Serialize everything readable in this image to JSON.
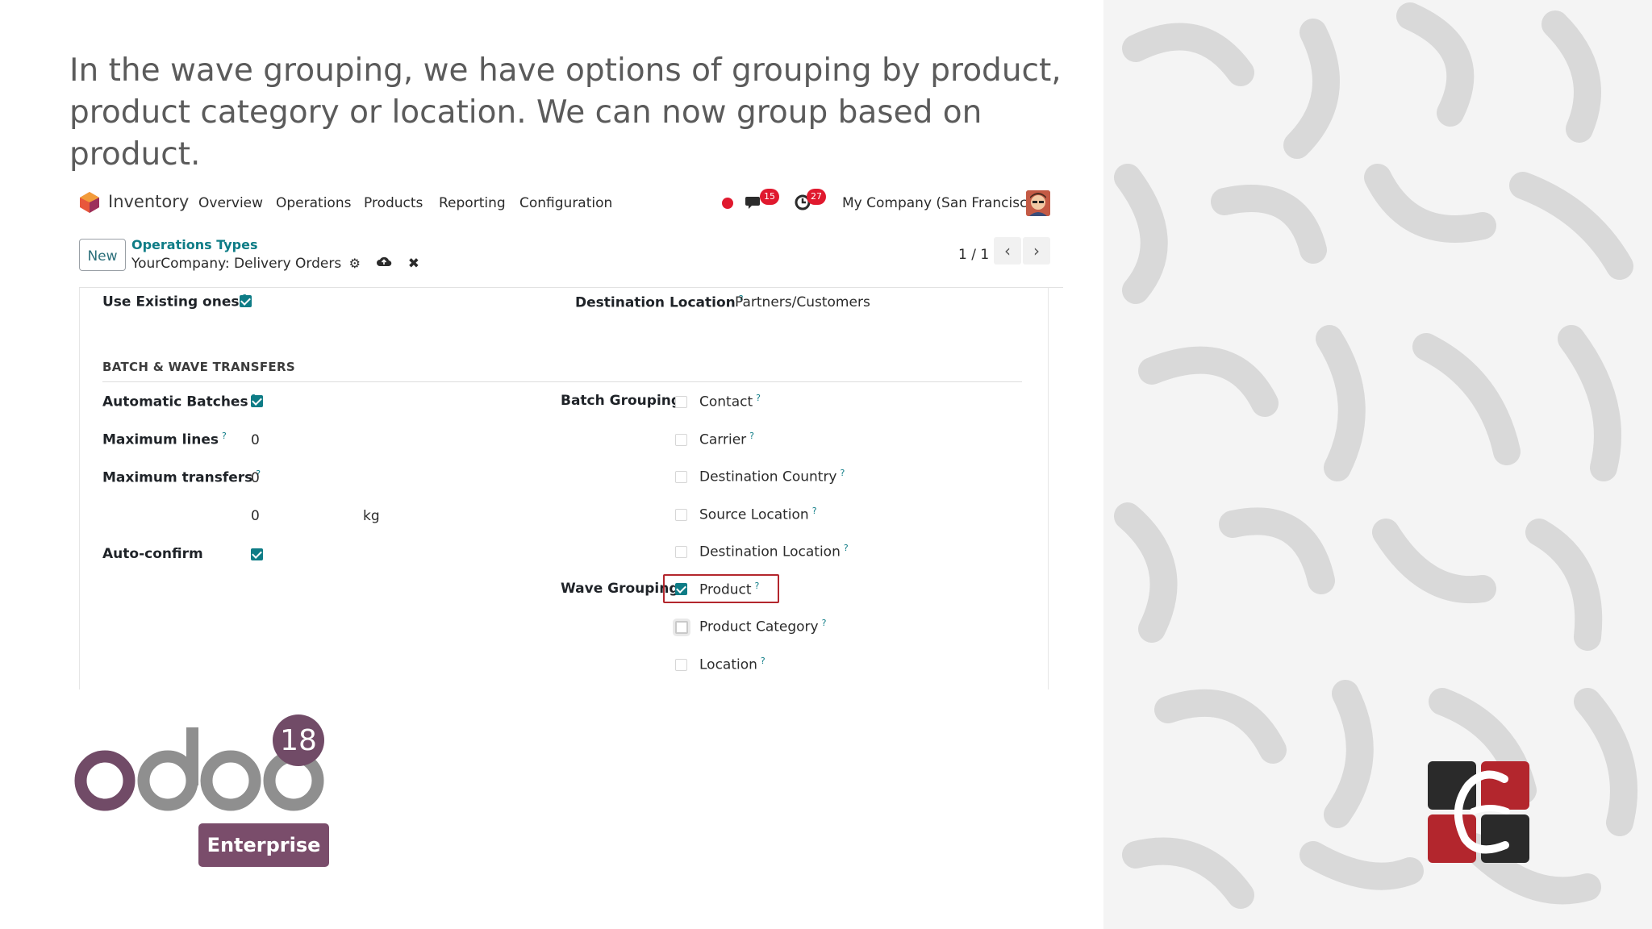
{
  "headline": "In the wave grouping, we have options of grouping by product, product category or location. We can now group based on product.",
  "navbar": {
    "app_name": "Inventory",
    "menu": [
      "Overview",
      "Operations",
      "Products",
      "Reporting",
      "Configuration"
    ],
    "messages_count": "15",
    "activities_count": "27",
    "company": "My Company (San Francisco)"
  },
  "control": {
    "new_label": "New",
    "breadcrumb": "Operations Types",
    "record_name": "YourCompany: Delivery Orders",
    "pager": "1 / 1"
  },
  "form": {
    "use_existing_label": "Use Existing ones",
    "use_existing_checked": true,
    "destination_location_label": "Destination Location",
    "destination_location_value": "Partners/Customers",
    "section_title": "BATCH & WAVE TRANSFERS",
    "automatic_batches_label": "Automatic Batches",
    "automatic_batches_checked": true,
    "maximum_lines_label": "Maximum lines",
    "maximum_lines_value": "0",
    "maximum_transfers_label": "Maximum transfers",
    "maximum_transfers_value": "0",
    "weight_value": "0",
    "weight_unit": "kg",
    "auto_confirm_label": "Auto-confirm",
    "auto_confirm_checked": true,
    "batch_grouping_label": "Batch Grouping",
    "batch_grouping_options": [
      {
        "label": "Contact",
        "checked": false
      },
      {
        "label": "Carrier",
        "checked": false
      },
      {
        "label": "Destination Country",
        "checked": false
      },
      {
        "label": "Source Location",
        "checked": false
      },
      {
        "label": "Destination Location",
        "checked": false
      }
    ],
    "wave_grouping_label": "Wave Grouping",
    "wave_grouping_options": [
      {
        "label": "Product",
        "checked": true
      },
      {
        "label": "Product Category",
        "checked": false
      },
      {
        "label": "Location",
        "checked": false
      }
    ]
  },
  "branding": {
    "odoo_version": "18",
    "edition": "Enterprise"
  },
  "colors": {
    "accent": "#0e7c86",
    "odoo_purple": "#7a4d6b",
    "highlight": "#b3262d",
    "badge": "#e0192e"
  }
}
